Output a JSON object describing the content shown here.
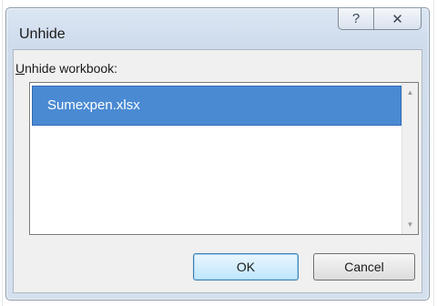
{
  "dialog": {
    "title": "Unhide",
    "help_glyph": "?",
    "close_glyph": "✕"
  },
  "list": {
    "label_accel": "U",
    "label_rest": "nhide workbook:",
    "items": [
      "Sumexpen.xlsx"
    ],
    "selected_index": 0
  },
  "buttons": {
    "ok_label": "OK",
    "cancel_label": "Cancel"
  },
  "colors": {
    "selection": "#4a8ad3",
    "dialog_frame": "#d4e0ee"
  }
}
